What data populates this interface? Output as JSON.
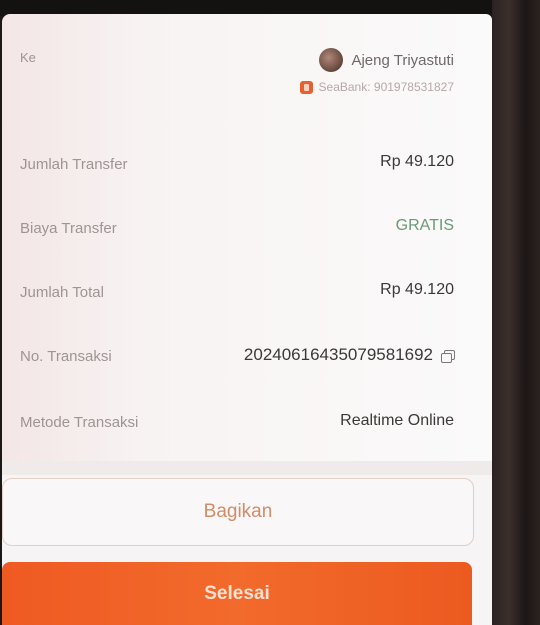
{
  "recipient": {
    "label": "Ke",
    "name": "Ajeng Triyastuti",
    "bank": "SeaBank: 901978531827"
  },
  "details": [
    {
      "label": "Jumlah Transfer",
      "value": "Rp 49.120"
    },
    {
      "label": "Biaya Transfer",
      "value": "GRATIS"
    },
    {
      "label": "Jumlah Total",
      "value": "Rp 49.120"
    },
    {
      "label": "No. Transaksi",
      "value": "20240616435079581692"
    },
    {
      "label": "Metode Transaksi",
      "value": "Realtime Online"
    }
  ],
  "buttons": {
    "share": "Bagikan",
    "done": "Selesai"
  },
  "colors": {
    "accent": "#F26A2C",
    "free_text": "#6A9A74"
  },
  "icons": {
    "copy": "copy-icon",
    "bank": "seabank-icon"
  }
}
